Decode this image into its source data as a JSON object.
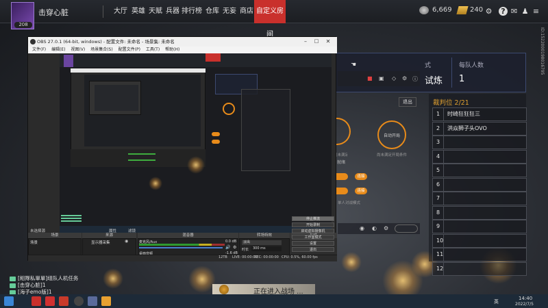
{
  "user": {
    "name": "击穿心脏",
    "level": "208"
  },
  "nav": {
    "items": [
      "大厅",
      "英雄",
      "天赋",
      "兵器",
      "排行榜",
      "仓库",
      "无妄",
      "商店",
      "自定义房间"
    ],
    "active": "自定义房间"
  },
  "resources": {
    "currency1": "6,669",
    "currency2": "240"
  },
  "colors": {
    "accent": "#c9302c",
    "panel": "#1c2030"
  },
  "obs": {
    "title": "OBS 27.0.1 (64-bit, windows) - 配置文件: 未命名 - 场景集: 未命名",
    "menu": [
      "文件(F)",
      "编辑(E)",
      "视图(V)",
      "场景集合(S)",
      "配置文件(P)",
      "工具(T)",
      "帮助(H)"
    ],
    "no_source": "未选择源",
    "properties_label": "属性",
    "filters_label": "滤镜",
    "docks": {
      "scenes": "场景",
      "sources": "来源",
      "mixer": "混音器",
      "transitions": "转场特效",
      "controls": "控件"
    },
    "scene_item": "场景",
    "source_item": "显示器采集",
    "mixer": [
      {
        "name": "麦克风/Aux",
        "db": "0.0 dB"
      },
      {
        "name": "桌面音频",
        "db": "-1.6 dB"
      }
    ],
    "transition": {
      "value": "淡出",
      "duration_label": "时长",
      "duration": "300 ms"
    },
    "controls": [
      "停止推流",
      "开始录制",
      "启动虚拟摄像机",
      "工作室模式",
      "设置",
      "退出"
    ],
    "status": {
      "live": "LIVE: 00:00:00",
      "rec": "REC: 00:00:00",
      "cpu": "CPU: 0.5%, 60.00 fps",
      "num": "12TB"
    }
  },
  "game": {
    "mode_label": "式",
    "mode_value": "试炼",
    "per_team_label": "每队人数",
    "per_team_value": "1",
    "exit": "退出",
    "slot_a": "自动开局",
    "slot_b": "单人对战模式",
    "slot_note": "尚未满足开局条件",
    "ready": "就绪",
    "btn": "连接",
    "judge_header": "裁判位 2/21",
    "judges": [
      "时崎狂狂狂三",
      "洪焱狮子头OVO",
      "",
      "",
      "",
      "",
      "",
      "",
      "",
      "",
      "",
      ""
    ],
    "judge_nums": [
      "1",
      "2",
      "3",
      "4",
      "5",
      "6",
      "7",
      "8",
      "9",
      "10",
      "11",
      "12"
    ],
    "loading": "正在进入战场 ..."
  },
  "chat": [
    {
      "tag": "[組隊私單單]",
      "msg": "组队人机任务"
    },
    {
      "tag": "[击穿心脏]",
      "msg": "1"
    },
    {
      "tag": "[海子emo版]",
      "msg": "1"
    }
  ],
  "tray": {
    "time": "14:40",
    "date": "2022/7/5",
    "lang": "英",
    "watermark": "ID:1522000198016795"
  }
}
